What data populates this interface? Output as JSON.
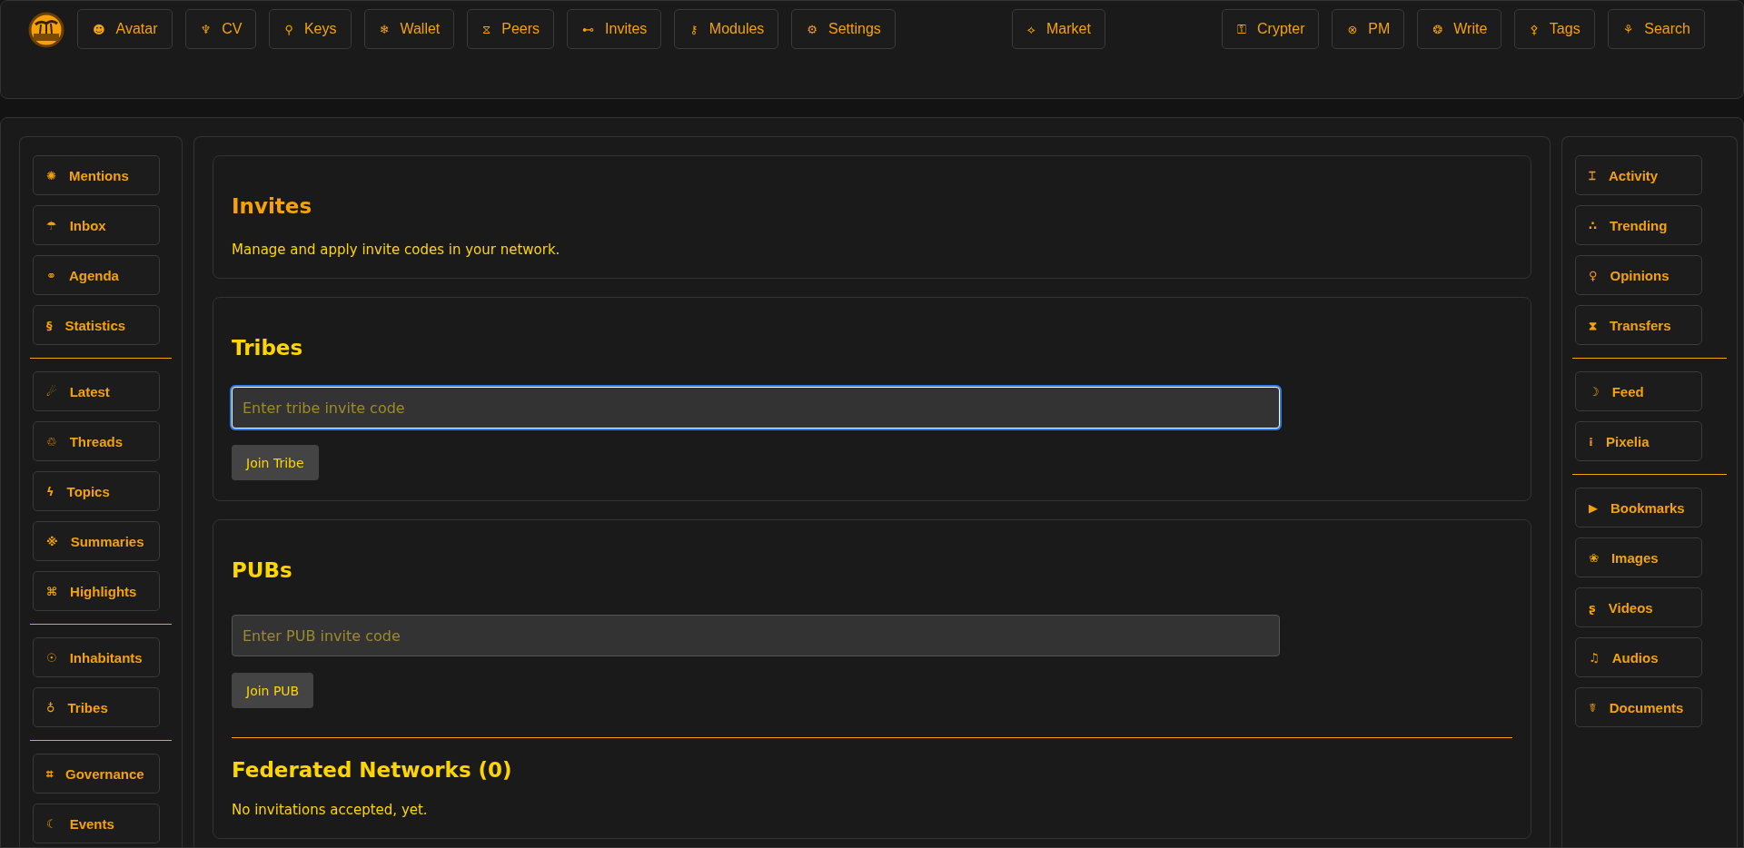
{
  "top_nav": {
    "left": [
      {
        "icon": "☻",
        "label": "Avatar"
      },
      {
        "icon": "♆",
        "label": "CV"
      },
      {
        "icon": "⚲",
        "label": "Keys"
      },
      {
        "icon": "❄",
        "label": "Wallet"
      },
      {
        "icon": "⧖",
        "label": "Peers"
      },
      {
        "icon": "⊷",
        "label": "Invites"
      },
      {
        "icon": "⚷",
        "label": "Modules"
      },
      {
        "icon": "⚙",
        "label": "Settings"
      }
    ],
    "center": [
      {
        "icon": "⟡",
        "label": "Market"
      }
    ],
    "right": [
      {
        "icon": "⚿",
        "label": "Crypter"
      },
      {
        "icon": "⊗",
        "label": "PM"
      },
      {
        "icon": "❂",
        "label": "Write"
      },
      {
        "icon": "⚴",
        "label": "Tags"
      },
      {
        "icon": "⚘",
        "label": "Search"
      }
    ]
  },
  "left_sidebar": [
    [
      {
        "icon": "✺",
        "label": "Mentions"
      },
      {
        "icon": "☂",
        "label": "Inbox"
      },
      {
        "icon": "⚭",
        "label": "Agenda"
      },
      {
        "icon": "§",
        "label": "Statistics"
      }
    ],
    [
      {
        "icon": "☄",
        "label": "Latest"
      },
      {
        "icon": "♲",
        "label": "Threads"
      },
      {
        "icon": "ϟ",
        "label": "Topics"
      },
      {
        "icon": "※",
        "label": "Summaries"
      },
      {
        "icon": "⌘",
        "label": "Highlights"
      }
    ],
    [
      {
        "icon": "☉",
        "label": "Inhabitants"
      },
      {
        "icon": "♁",
        "label": "Tribes"
      }
    ],
    [
      {
        "icon": "⌗",
        "label": "Governance"
      },
      {
        "icon": "☾",
        "label": "Events"
      }
    ]
  ],
  "invites": {
    "title": "Invites",
    "description": "Manage and apply invite codes in your network."
  },
  "tribes": {
    "title": "Tribes",
    "placeholder": "Enter tribe invite code",
    "focused": true,
    "button": "Join Tribe"
  },
  "pubs": {
    "title": "PUBs",
    "placeholder": "Enter PUB invite code",
    "focused": false,
    "button": "Join PUB"
  },
  "federated": {
    "title": "Federated Networks (0)",
    "text": "No invitations accepted, yet."
  },
  "right_sidebar": [
    [
      {
        "icon": "⌶",
        "label": "Activity"
      },
      {
        "icon": "∴",
        "label": "Trending"
      },
      {
        "icon": "♀",
        "label": "Opinions"
      },
      {
        "icon": "⧗",
        "label": "Transfers"
      }
    ],
    [
      {
        "icon": "☽",
        "label": "Feed"
      },
      {
        "icon": "⁞",
        "label": "Pixelia"
      }
    ],
    [
      {
        "icon": "▶",
        "label": "Bookmarks"
      },
      {
        "icon": "❀",
        "label": "Images"
      },
      {
        "icon": "ʂ",
        "label": "Videos"
      },
      {
        "icon": "♫",
        "label": "Audios"
      },
      {
        "icon": "☤",
        "label": "Documents"
      }
    ]
  ]
}
